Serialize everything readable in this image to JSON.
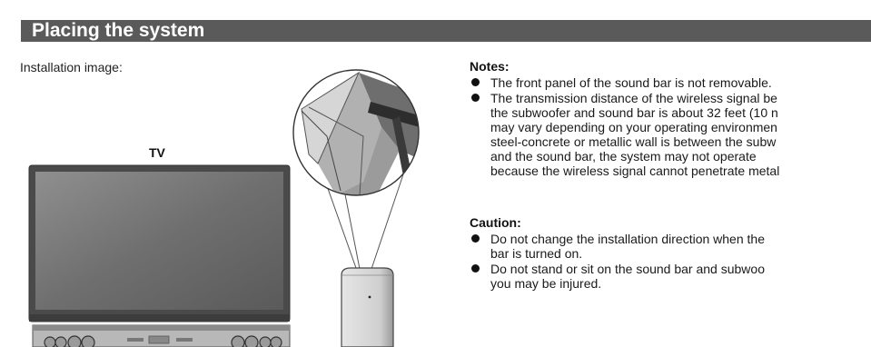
{
  "header": {
    "title": "Placing the system"
  },
  "installation": {
    "label": "Installation image:",
    "tv_label": "TV"
  },
  "notes": {
    "heading": "Notes:",
    "items": [
      "The front panel of the sound bar is not removable.",
      "The transmission distance of the wireless signal be\nthe subwoofer and sound bar is about 32 feet (10 n\nmay vary depending on your operating environmen\nsteel-concrete or metallic wall is between the subw\nand the sound bar, the system may not operate\nbecause the wireless signal cannot penetrate metal"
    ]
  },
  "caution": {
    "heading": "Caution:",
    "items": [
      "Do not change the installation direction when the\nbar is turned on.",
      "Do not stand or sit on the sound bar and subwoo\nyou may be injured."
    ]
  },
  "colors": {
    "banner_bg": "#5a5a5a",
    "banner_text": "#ffffff",
    "body_text": "#1a1a1a"
  }
}
